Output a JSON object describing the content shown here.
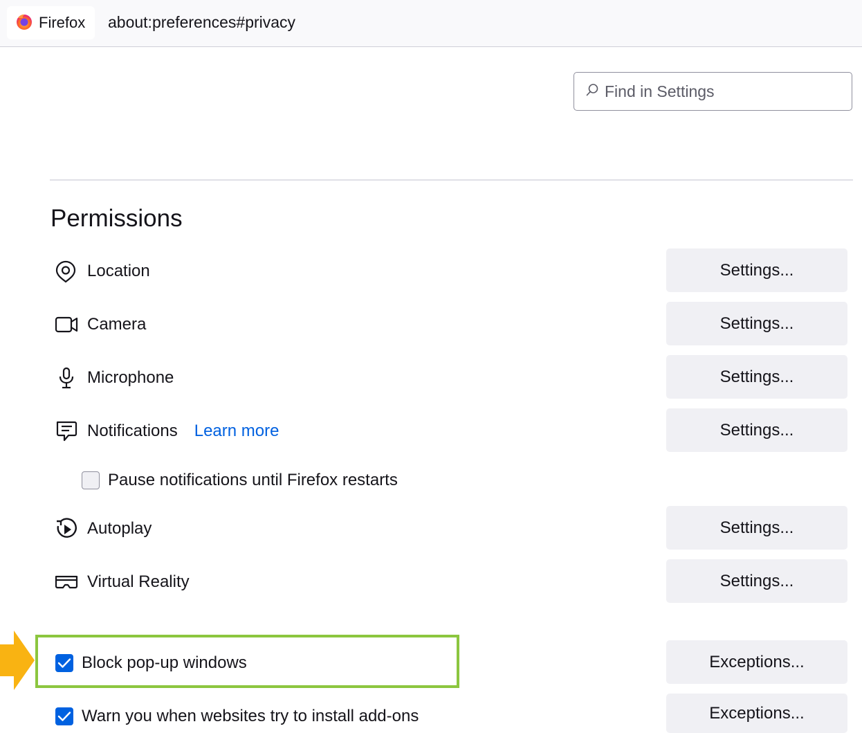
{
  "browser": {
    "identity_label": "Firefox",
    "url": "about:preferences#privacy"
  },
  "search": {
    "placeholder": "Find in Settings",
    "value": ""
  },
  "permissions": {
    "title": "Permissions",
    "items": [
      {
        "label": "Location",
        "icon": "location-pin-icon",
        "button": "Settings..."
      },
      {
        "label": "Camera",
        "icon": "camera-icon",
        "button": "Settings..."
      },
      {
        "label": "Microphone",
        "icon": "microphone-icon",
        "button": "Settings..."
      },
      {
        "label": "Notifications",
        "icon": "notification-bubble-icon",
        "button": "Settings...",
        "link": "Learn more"
      },
      {
        "label": "Autoplay",
        "icon": "autoplay-icon",
        "button": "Settings..."
      },
      {
        "label": "Virtual Reality",
        "icon": "vr-headset-icon",
        "button": "Settings..."
      }
    ],
    "pause_notifications": {
      "label": "Pause notifications until Firefox restarts",
      "checked": false
    },
    "block_popups": {
      "label": "Block pop-up windows",
      "checked": true,
      "button": "Exceptions..."
    },
    "warn_addons": {
      "label": "Warn you when websites try to install add-ons",
      "checked": true,
      "button": "Exceptions..."
    }
  },
  "colors": {
    "accent": "#0061e0",
    "link": "#0061e0",
    "highlight_box": "#8cc63f",
    "arrow": "#f9b312",
    "button_bg": "#f0f0f4"
  }
}
